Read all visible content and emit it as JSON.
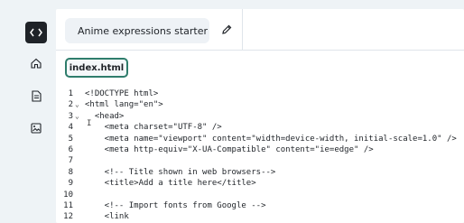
{
  "rail": {
    "items": [
      {
        "name": "code-icon",
        "active": true
      },
      {
        "name": "home-icon",
        "active": false
      },
      {
        "name": "document-icon",
        "active": false
      },
      {
        "name": "image-icon",
        "active": false
      }
    ]
  },
  "header": {
    "project_title": "Anime expressions starter",
    "edit_icon": "pencil-icon"
  },
  "file_tab": {
    "label": "index.html"
  },
  "editor": {
    "lines": [
      {
        "n": "1",
        "fold": "",
        "code": "<!DOCTYPE html>"
      },
      {
        "n": "2",
        "fold": "⌄",
        "code": "<html lang=\"en\">"
      },
      {
        "n": "3",
        "fold": "⌄",
        "code": "  <head>"
      },
      {
        "n": "4",
        "fold": "",
        "code": "    <meta charset=\"UTF-8\" />"
      },
      {
        "n": "5",
        "fold": "",
        "code": "    <meta name=\"viewport\" content=\"width=device-width, initial-scale=1.0\" />"
      },
      {
        "n": "6",
        "fold": "",
        "code": "    <meta http-equiv=\"X-UA-Compatible\" content=\"ie=edge\" />"
      },
      {
        "n": "7",
        "fold": "",
        "code": ""
      },
      {
        "n": "8",
        "fold": "",
        "code": "    <!-- Title shown in web browsers-->"
      },
      {
        "n": "9",
        "fold": "",
        "code": "    <title>Add a title here</title>"
      },
      {
        "n": "10",
        "fold": "",
        "code": ""
      },
      {
        "n": "11",
        "fold": "",
        "code": "    <!-- Import fonts from Google -->"
      },
      {
        "n": "12",
        "fold": "",
        "code": "    <link"
      }
    ]
  },
  "colors": {
    "accent": "#2f7d6c",
    "tag_name": "#0b7a3b",
    "attr_value": "#c0392b",
    "comment": "#c0392b"
  }
}
